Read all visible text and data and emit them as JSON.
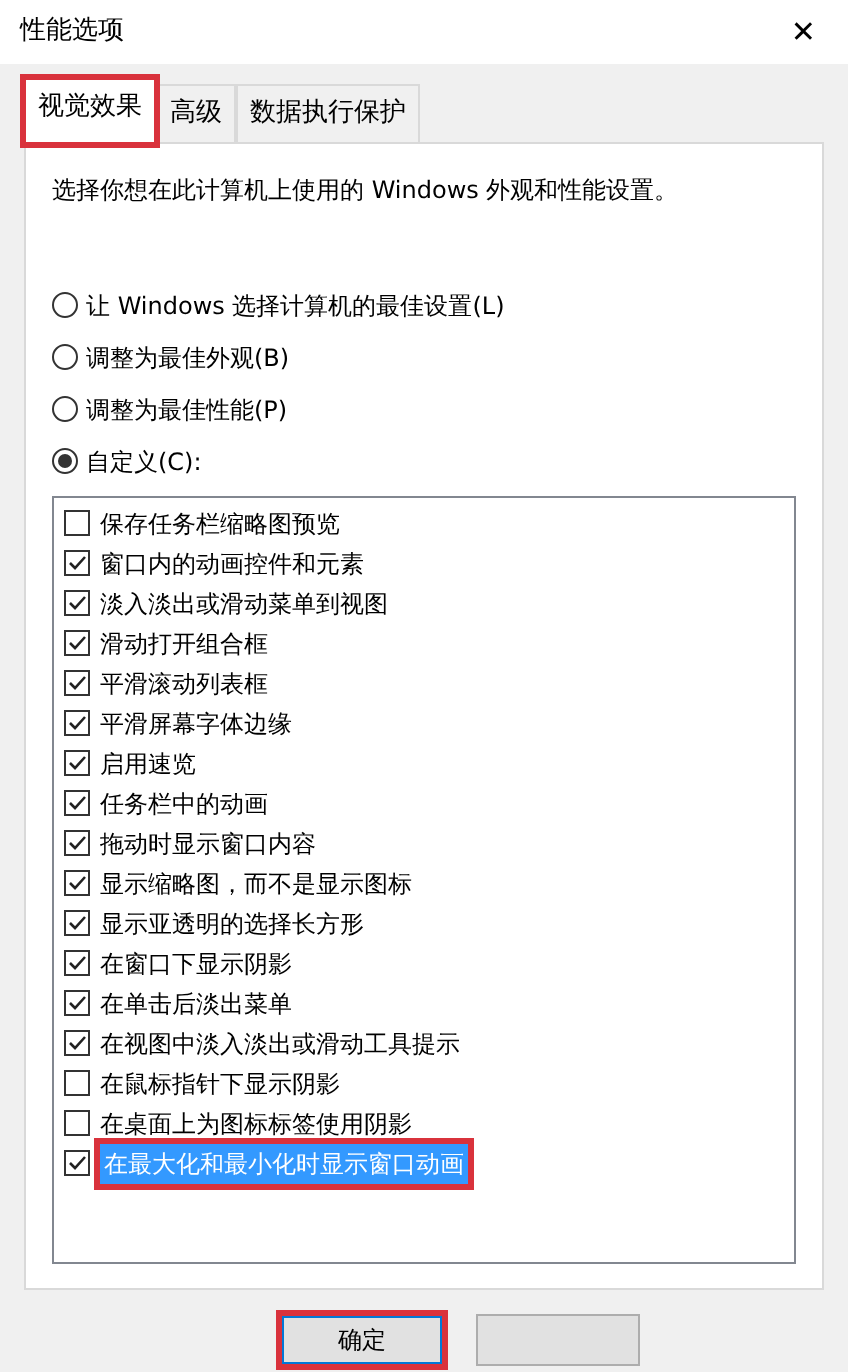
{
  "window": {
    "title": "性能选项",
    "close": "✕"
  },
  "tabs": [
    {
      "label": "视觉效果",
      "selected": true,
      "highlighted": true
    },
    {
      "label": "高级",
      "selected": false,
      "highlighted": false
    },
    {
      "label": "数据执行保护",
      "selected": false,
      "highlighted": false
    }
  ],
  "description": "选择你想在此计算机上使用的 Windows 外观和性能设置。",
  "options": [
    {
      "label": "让 Windows 选择计算机的最佳设置(L)",
      "selected": false
    },
    {
      "label": "调整为最佳外观(B)",
      "selected": false
    },
    {
      "label": "调整为最佳性能(P)",
      "selected": false
    },
    {
      "label": "自定义(C):",
      "selected": true
    }
  ],
  "effects": [
    {
      "label": "保存任务栏缩略图预览",
      "checked": false,
      "selected": false
    },
    {
      "label": "窗口内的动画控件和元素",
      "checked": true,
      "selected": false
    },
    {
      "label": "淡入淡出或滑动菜单到视图",
      "checked": true,
      "selected": false
    },
    {
      "label": "滑动打开组合框",
      "checked": true,
      "selected": false
    },
    {
      "label": "平滑滚动列表框",
      "checked": true,
      "selected": false
    },
    {
      "label": "平滑屏幕字体边缘",
      "checked": true,
      "selected": false
    },
    {
      "label": "启用速览",
      "checked": true,
      "selected": false
    },
    {
      "label": "任务栏中的动画",
      "checked": true,
      "selected": false
    },
    {
      "label": "拖动时显示窗口内容",
      "checked": true,
      "selected": false
    },
    {
      "label": "显示缩略图，而不是显示图标",
      "checked": true,
      "selected": false
    },
    {
      "label": "显示亚透明的选择长方形",
      "checked": true,
      "selected": false
    },
    {
      "label": "在窗口下显示阴影",
      "checked": true,
      "selected": false
    },
    {
      "label": "在单击后淡出菜单",
      "checked": true,
      "selected": false
    },
    {
      "label": "在视图中淡入淡出或滑动工具提示",
      "checked": true,
      "selected": false
    },
    {
      "label": "在鼠标指针下显示阴影",
      "checked": false,
      "selected": false
    },
    {
      "label": "在桌面上为图标标签使用阴影",
      "checked": false,
      "selected": false
    },
    {
      "label": "在最大化和最小化时显示窗口动画",
      "checked": true,
      "selected": true
    }
  ],
  "buttons": [
    {
      "label": "确定",
      "highlighted": true
    },
    {
      "kind": "blank",
      "highlighted": false
    }
  ]
}
